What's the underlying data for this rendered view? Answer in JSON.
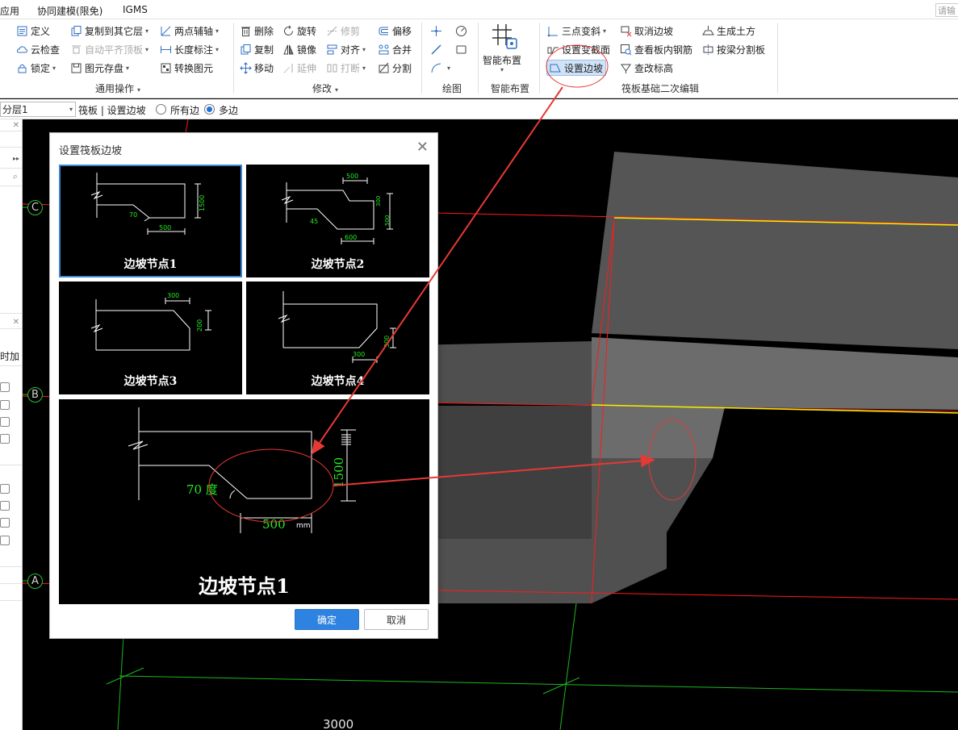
{
  "menubar": {
    "items": [
      "应用",
      "协同建模(限免)",
      "IGMS"
    ],
    "search_placeholder": "请输"
  },
  "ribbon": {
    "general": {
      "define": "定义",
      "copy_to_floor": "复制到其它层",
      "cloud_check": "云检查",
      "auto_align_top": "自动平齐顶板",
      "lock": "锁定",
      "element_save": "图元存盘",
      "two_point_axis": "两点辅轴",
      "length_mark": "长度标注",
      "convert_element": "转换图元",
      "group_label": "通用操作"
    },
    "modify": {
      "delete": "删除",
      "rotate": "旋转",
      "trim": "修剪",
      "offset": "偏移",
      "copy": "复制",
      "mirror": "镜像",
      "align": "对齐",
      "merge": "合并",
      "move": "移动",
      "extend": "延伸",
      "break": "打断",
      "split": "分割",
      "group_label": "修改"
    },
    "draw": {
      "group_label": "绘图"
    },
    "smart": {
      "button": "智能布置",
      "group_label": "智能布置"
    },
    "raft_edit": {
      "three_point_slope": "三点变斜",
      "cancel_slope": "取消边坡",
      "generate_earthwork": "生成土方",
      "set_variable_section": "设置变截面",
      "view_rebar": "查看板内钢筋",
      "split_by_beam": "按梁分割板",
      "set_slope": "设置边坡",
      "change_elevation": "查改标高",
      "group_label": "筏板基础二次编辑"
    }
  },
  "propbar": {
    "floor": "分层1",
    "breadcrumb": "筏板 | 设置边坡",
    "radio_all": "所有边",
    "radio_multi": "多边"
  },
  "leftpanel": {
    "partial_label": "时加"
  },
  "canvas": {
    "axis_labels": [
      "C",
      "B",
      "A"
    ],
    "dimension": "3000"
  },
  "dialog": {
    "title": "设置筏板边坡",
    "options": [
      {
        "label": "边坡节点1",
        "angle": "70",
        "width": "500",
        "height": "1500"
      },
      {
        "label": "边坡节点2",
        "angle": "45",
        "width_top": "500",
        "width_bottom": "600",
        "height1": "300",
        "height2": "500"
      },
      {
        "label": "边坡节点3",
        "width": "300",
        "height": "200"
      },
      {
        "label": "边坡节点4",
        "width": "300",
        "height": "300"
      }
    ],
    "preview": {
      "label": "边坡节点1",
      "angle_text": "70 度",
      "width": "500",
      "height": "1500",
      "unit": "mm"
    },
    "ok": "确定",
    "cancel": "取消"
  },
  "colors": {
    "accent": "#2f83e0",
    "selection_outline": "#3c86d6",
    "annotation_red": "#e53935",
    "grid_red": "#ff1a1a",
    "grid_green": "#1fb51f",
    "edge_yellow": "#f2f200",
    "dim_green": "#22ee22"
  }
}
